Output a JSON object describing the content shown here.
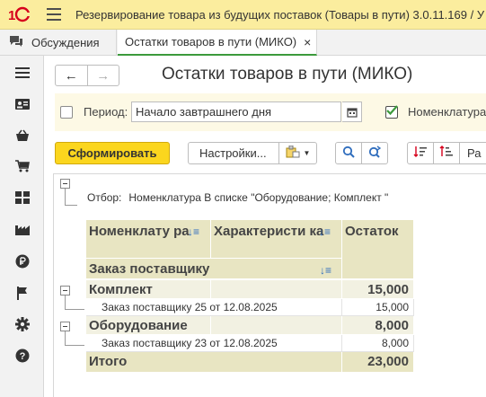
{
  "titlebar": {
    "logo": "1С",
    "title": "Резервирование товара из будущих поставок (Товары в пути) 3.0.11.169 / У"
  },
  "tabs": {
    "discussions": "Обсуждения",
    "active": "Остатки товаров в пути (МИКО)",
    "close": "×"
  },
  "sidebar": [
    "menu-icon",
    "contacts-icon",
    "basket-icon",
    "cart-icon",
    "grid-icon",
    "production-icon",
    "ruble-icon",
    "flag-icon",
    "gear-icon",
    "help-icon"
  ],
  "form": {
    "back": "←",
    "forward": "→",
    "title": "Остатки товаров в пути (МИКО)"
  },
  "params": {
    "period_label": "Период:",
    "period_value": "Начало завтрашнего дня",
    "period_checked": false,
    "nomenclature_label": "Номенклатура:",
    "nomenclature_checked": true
  },
  "toolbar": {
    "generate": "Сформировать",
    "settings": "Настройки...",
    "more": "Ра"
  },
  "report": {
    "filter_label": "Отбор:",
    "filter_value": "Номенклатура В списке \"Оборудование; Комплект \"",
    "headers": {
      "nomenclature": "Номенклату ра",
      "characteristic": "Характеристи ка",
      "remainder": "Остаток",
      "supplier_order": "Заказ поставщику"
    },
    "rows": [
      {
        "kind": "group",
        "name": "Комплект",
        "value": "15,000"
      },
      {
        "kind": "detail",
        "name": "Заказ поставщику 25 от 12.08.2025",
        "value": "15,000"
      },
      {
        "kind": "group",
        "name": "Оборудование",
        "value": "8,000"
      },
      {
        "kind": "detail",
        "name": "Заказ поставщику 23 от 12.08.2025",
        "value": "8,000"
      }
    ],
    "total_label": "Итого",
    "total_value": "23,000"
  },
  "colors": {
    "titlebar": "#fbed9e",
    "primary_button": "#fbd61e",
    "header_cells": "#e8e5c2",
    "group_cells": "#f2f1e2",
    "accent_green": "#3c9a3c",
    "link_blue": "#2f6dbd"
  }
}
